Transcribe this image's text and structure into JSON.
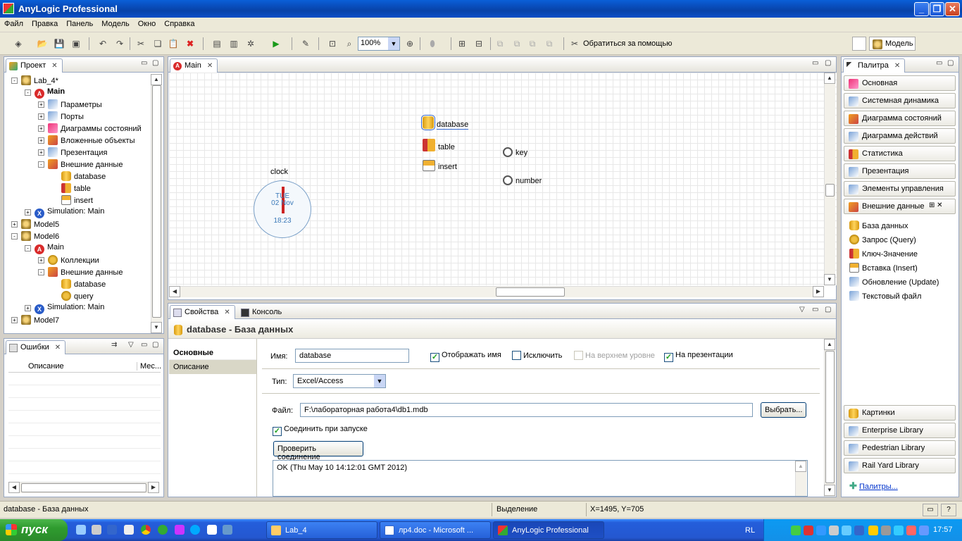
{
  "window": {
    "title": "AnyLogic Professional"
  },
  "menu": [
    "Файл",
    "Правка",
    "Панель",
    "Модель",
    "Окно",
    "Справка"
  ],
  "toolbar": {
    "zoom": "100%",
    "help": "Обратиться за помощью",
    "perspective": "Модель"
  },
  "project": {
    "tab": "Проект",
    "tree": [
      {
        "label": "Lab_4*",
        "indent": 0,
        "exp": "-",
        "icon": "model",
        "bold": false
      },
      {
        "label": "Main",
        "indent": 1,
        "exp": "-",
        "icon": "agent",
        "bold": true
      },
      {
        "label": "Параметры",
        "indent": 2,
        "exp": "+",
        "icon": "gen",
        "bold": false
      },
      {
        "label": "Порты",
        "indent": 2,
        "exp": "+",
        "icon": "gen",
        "bold": false
      },
      {
        "label": "Диаграммы состояний",
        "indent": 2,
        "exp": "+",
        "icon": "pink",
        "bold": false
      },
      {
        "label": "Вложенные объекты",
        "indent": 2,
        "exp": "+",
        "icon": "ext",
        "bold": false
      },
      {
        "label": "Презентация",
        "indent": 2,
        "exp": "+",
        "icon": "gen",
        "bold": false
      },
      {
        "label": "Внешние данные",
        "indent": 2,
        "exp": "-",
        "icon": "ext",
        "bold": false
      },
      {
        "label": "database",
        "indent": 3,
        "exp": "",
        "icon": "db",
        "bold": false
      },
      {
        "label": "table",
        "indent": 3,
        "exp": "",
        "icon": "tbl",
        "bold": false
      },
      {
        "label": "insert",
        "indent": 3,
        "exp": "",
        "icon": "ins",
        "bold": false
      },
      {
        "label": "Simulation: Main",
        "indent": 1,
        "exp": "+",
        "icon": "sim",
        "bold": false
      },
      {
        "label": "Model5",
        "indent": 0,
        "exp": "+",
        "icon": "model",
        "bold": false
      },
      {
        "label": "Model6",
        "indent": 0,
        "exp": "-",
        "icon": "model",
        "bold": false
      },
      {
        "label": "Main",
        "indent": 1,
        "exp": "-",
        "icon": "agent",
        "bold": false
      },
      {
        "label": "Коллекции",
        "indent": 2,
        "exp": "+",
        "icon": "gear",
        "bold": false
      },
      {
        "label": "Внешние данные",
        "indent": 2,
        "exp": "-",
        "icon": "ext",
        "bold": false
      },
      {
        "label": "database",
        "indent": 3,
        "exp": "",
        "icon": "db",
        "bold": false
      },
      {
        "label": "query",
        "indent": 3,
        "exp": "",
        "icon": "gear",
        "bold": false
      },
      {
        "label": "Simulation: Main",
        "indent": 1,
        "exp": "+",
        "icon": "sim",
        "bold": false
      },
      {
        "label": "Model7",
        "indent": 0,
        "exp": "+",
        "icon": "model",
        "bold": false
      }
    ]
  },
  "errors": {
    "tab": "Ошибки",
    "col_desc": "Описание",
    "col_place": "Мес..."
  },
  "editor": {
    "tab": "Main",
    "objects": {
      "database": "database",
      "table": "table",
      "insert": "insert",
      "key": "key",
      "number": "number",
      "clock": "clock"
    },
    "clock": {
      "day": "TUE",
      "date": "02 Nov",
      "time": "18:23"
    }
  },
  "palette": {
    "tab": "Палитра",
    "sections": [
      "Основная",
      "Системная динамика",
      "Диаграмма состояний",
      "Диаграмма действий",
      "Статистика",
      "Презентация",
      "Элементы управления",
      "Внешние данные"
    ],
    "items": [
      "База данных",
      "Запрос (Query)",
      "Ключ-Значение",
      "Вставка (Insert)",
      "Обновление (Update)",
      "Текстовый файл"
    ],
    "bottom": [
      "Картинки",
      "Enterprise Library",
      "Pedestrian Library",
      "Rail Yard Library"
    ],
    "more": "Палитры..."
  },
  "properties": {
    "tab_props": "Свойства",
    "tab_console": "Консоль",
    "header": "database - База данных",
    "left_tabs": [
      "Основные",
      "Описание"
    ],
    "name_label": "Имя:",
    "name_value": "database",
    "show_name": "Отображать имя",
    "exclude": "Исключить",
    "top_level": "На верхнем уровне",
    "on_presentation": "На презентации",
    "type_label": "Тип:",
    "type_value": "Excel/Access",
    "file_label": "Файл:",
    "file_value": "F:\\лабораторная работа4\\db1.mdb",
    "browse": "Выбрать...",
    "connect_on_start": "Соединить при запуске",
    "test_connection": "Проверить соединение",
    "output": "OK (Thu May 10 14:12:01 GMT 2012)"
  },
  "status": {
    "left": "database - База данных",
    "mode": "Выделение",
    "coords": "X=1495, Y=705"
  },
  "taskbar": {
    "start": "пуск",
    "tasks": [
      "Lab_4",
      "лр4.doc - Microsoft ...",
      "AnyLogic Professional"
    ],
    "lang": "RL",
    "time": "17:57"
  }
}
